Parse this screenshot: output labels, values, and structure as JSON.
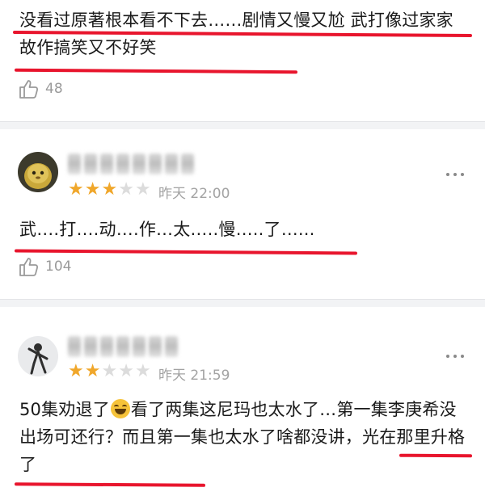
{
  "comments": [
    {
      "text": "没看过原著根本看不下去……剧情又慢又尬 武打像过家家 故作搞笑又不好笑",
      "likes": "48"
    },
    {
      "rating": 3,
      "time": "昨天 22:00",
      "text": "武….打….动….作…太…..慢…..了…...",
      "likes": "104"
    },
    {
      "rating": 2,
      "time": "昨天 21:59",
      "text_part1": "50集劝退了",
      "text_part2": "看了两集这尼玛也太水了…第一集李庚希没出场可还行？而且第一集也太水了啥都没讲，光在那里升格了"
    }
  ],
  "colors": {
    "underline": "#e8152d",
    "star": "#f0a72b",
    "star_empty": "#dcdcdc"
  },
  "icons": [
    "thumbs-up-icon",
    "more-icon",
    "smiling-sweat-emoji"
  ]
}
